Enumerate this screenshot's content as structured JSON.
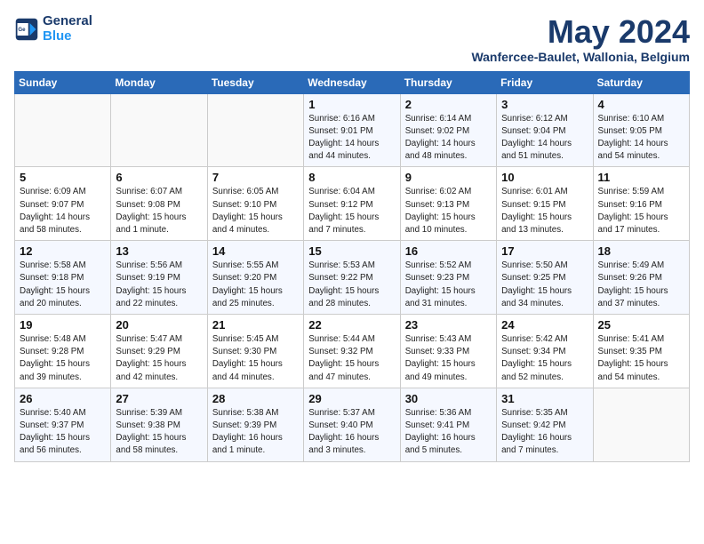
{
  "header": {
    "logo_line1": "General",
    "logo_line2": "Blue",
    "month_title": "May 2024",
    "subtitle": "Wanfercee-Baulet, Wallonia, Belgium"
  },
  "days_of_week": [
    "Sunday",
    "Monday",
    "Tuesday",
    "Wednesday",
    "Thursday",
    "Friday",
    "Saturday"
  ],
  "weeks": [
    [
      {
        "day": "",
        "info": ""
      },
      {
        "day": "",
        "info": ""
      },
      {
        "day": "",
        "info": ""
      },
      {
        "day": "1",
        "info": "Sunrise: 6:16 AM\nSunset: 9:01 PM\nDaylight: 14 hours\nand 44 minutes."
      },
      {
        "day": "2",
        "info": "Sunrise: 6:14 AM\nSunset: 9:02 PM\nDaylight: 14 hours\nand 48 minutes."
      },
      {
        "day": "3",
        "info": "Sunrise: 6:12 AM\nSunset: 9:04 PM\nDaylight: 14 hours\nand 51 minutes."
      },
      {
        "day": "4",
        "info": "Sunrise: 6:10 AM\nSunset: 9:05 PM\nDaylight: 14 hours\nand 54 minutes."
      }
    ],
    [
      {
        "day": "5",
        "info": "Sunrise: 6:09 AM\nSunset: 9:07 PM\nDaylight: 14 hours\nand 58 minutes."
      },
      {
        "day": "6",
        "info": "Sunrise: 6:07 AM\nSunset: 9:08 PM\nDaylight: 15 hours\nand 1 minute."
      },
      {
        "day": "7",
        "info": "Sunrise: 6:05 AM\nSunset: 9:10 PM\nDaylight: 15 hours\nand 4 minutes."
      },
      {
        "day": "8",
        "info": "Sunrise: 6:04 AM\nSunset: 9:12 PM\nDaylight: 15 hours\nand 7 minutes."
      },
      {
        "day": "9",
        "info": "Sunrise: 6:02 AM\nSunset: 9:13 PM\nDaylight: 15 hours\nand 10 minutes."
      },
      {
        "day": "10",
        "info": "Sunrise: 6:01 AM\nSunset: 9:15 PM\nDaylight: 15 hours\nand 13 minutes."
      },
      {
        "day": "11",
        "info": "Sunrise: 5:59 AM\nSunset: 9:16 PM\nDaylight: 15 hours\nand 17 minutes."
      }
    ],
    [
      {
        "day": "12",
        "info": "Sunrise: 5:58 AM\nSunset: 9:18 PM\nDaylight: 15 hours\nand 20 minutes."
      },
      {
        "day": "13",
        "info": "Sunrise: 5:56 AM\nSunset: 9:19 PM\nDaylight: 15 hours\nand 22 minutes."
      },
      {
        "day": "14",
        "info": "Sunrise: 5:55 AM\nSunset: 9:20 PM\nDaylight: 15 hours\nand 25 minutes."
      },
      {
        "day": "15",
        "info": "Sunrise: 5:53 AM\nSunset: 9:22 PM\nDaylight: 15 hours\nand 28 minutes."
      },
      {
        "day": "16",
        "info": "Sunrise: 5:52 AM\nSunset: 9:23 PM\nDaylight: 15 hours\nand 31 minutes."
      },
      {
        "day": "17",
        "info": "Sunrise: 5:50 AM\nSunset: 9:25 PM\nDaylight: 15 hours\nand 34 minutes."
      },
      {
        "day": "18",
        "info": "Sunrise: 5:49 AM\nSunset: 9:26 PM\nDaylight: 15 hours\nand 37 minutes."
      }
    ],
    [
      {
        "day": "19",
        "info": "Sunrise: 5:48 AM\nSunset: 9:28 PM\nDaylight: 15 hours\nand 39 minutes."
      },
      {
        "day": "20",
        "info": "Sunrise: 5:47 AM\nSunset: 9:29 PM\nDaylight: 15 hours\nand 42 minutes."
      },
      {
        "day": "21",
        "info": "Sunrise: 5:45 AM\nSunset: 9:30 PM\nDaylight: 15 hours\nand 44 minutes."
      },
      {
        "day": "22",
        "info": "Sunrise: 5:44 AM\nSunset: 9:32 PM\nDaylight: 15 hours\nand 47 minutes."
      },
      {
        "day": "23",
        "info": "Sunrise: 5:43 AM\nSunset: 9:33 PM\nDaylight: 15 hours\nand 49 minutes."
      },
      {
        "day": "24",
        "info": "Sunrise: 5:42 AM\nSunset: 9:34 PM\nDaylight: 15 hours\nand 52 minutes."
      },
      {
        "day": "25",
        "info": "Sunrise: 5:41 AM\nSunset: 9:35 PM\nDaylight: 15 hours\nand 54 minutes."
      }
    ],
    [
      {
        "day": "26",
        "info": "Sunrise: 5:40 AM\nSunset: 9:37 PM\nDaylight: 15 hours\nand 56 minutes."
      },
      {
        "day": "27",
        "info": "Sunrise: 5:39 AM\nSunset: 9:38 PM\nDaylight: 15 hours\nand 58 minutes."
      },
      {
        "day": "28",
        "info": "Sunrise: 5:38 AM\nSunset: 9:39 PM\nDaylight: 16 hours\nand 1 minute."
      },
      {
        "day": "29",
        "info": "Sunrise: 5:37 AM\nSunset: 9:40 PM\nDaylight: 16 hours\nand 3 minutes."
      },
      {
        "day": "30",
        "info": "Sunrise: 5:36 AM\nSunset: 9:41 PM\nDaylight: 16 hours\nand 5 minutes."
      },
      {
        "day": "31",
        "info": "Sunrise: 5:35 AM\nSunset: 9:42 PM\nDaylight: 16 hours\nand 7 minutes."
      },
      {
        "day": "",
        "info": ""
      }
    ]
  ]
}
